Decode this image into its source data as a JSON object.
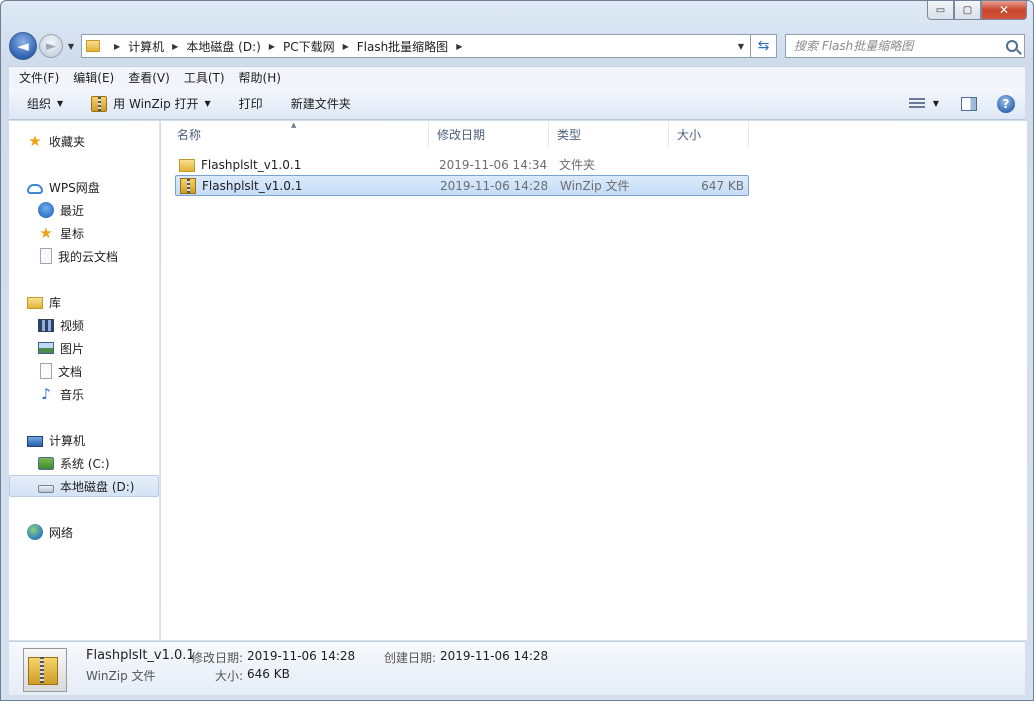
{
  "window": {
    "caption": {
      "minimize": "▭",
      "maximize": "▢",
      "close": "✕"
    }
  },
  "address": {
    "back_icon": "◄",
    "forward_icon": "►",
    "crumbs": [
      "计算机",
      "本地磁盘 (D:)",
      "PC下载网",
      "Flash批量缩略图"
    ],
    "search_placeholder": "搜索 Flash批量缩略图"
  },
  "menu": [
    "文件(F)",
    "编辑(E)",
    "查看(V)",
    "工具(T)",
    "帮助(H)"
  ],
  "toolbar": {
    "organize": "组织",
    "open_with": "用 WinZip 打开",
    "print": "打印",
    "new_folder": "新建文件夹",
    "help": "?"
  },
  "nav": {
    "favorites": "收藏夹",
    "wps": "WPS网盘",
    "recent": "最近",
    "starred": "星标",
    "cloud_docs": "我的云文档",
    "library": "库",
    "videos": "视频",
    "pictures": "图片",
    "documents": "文档",
    "music": "音乐",
    "computer": "计算机",
    "drive_c": "系统 (C:)",
    "drive_d": "本地磁盘 (D:)",
    "network": "网络"
  },
  "columns": {
    "name": "名称",
    "modified": "修改日期",
    "type": "类型",
    "size": "大小"
  },
  "files": [
    {
      "name": "Flashplslt_v1.0.1",
      "modified": "2019-11-06 14:34",
      "type": "文件夹",
      "size": "",
      "icon": "folder-icon"
    },
    {
      "name": "Flashplslt_v1.0.1",
      "modified": "2019-11-06 14:28",
      "type": "WinZip 文件",
      "size": "647 KB",
      "icon": "winzip-icon"
    }
  ],
  "details": {
    "name": "Flashplslt_v1.0.1",
    "modified_label": "修改日期:",
    "modified": "2019-11-06 14:28",
    "created_label": "创建日期:",
    "created": "2019-11-06 14:28",
    "type": "WinZip 文件",
    "size_label": "大小:",
    "size": "646 KB"
  }
}
